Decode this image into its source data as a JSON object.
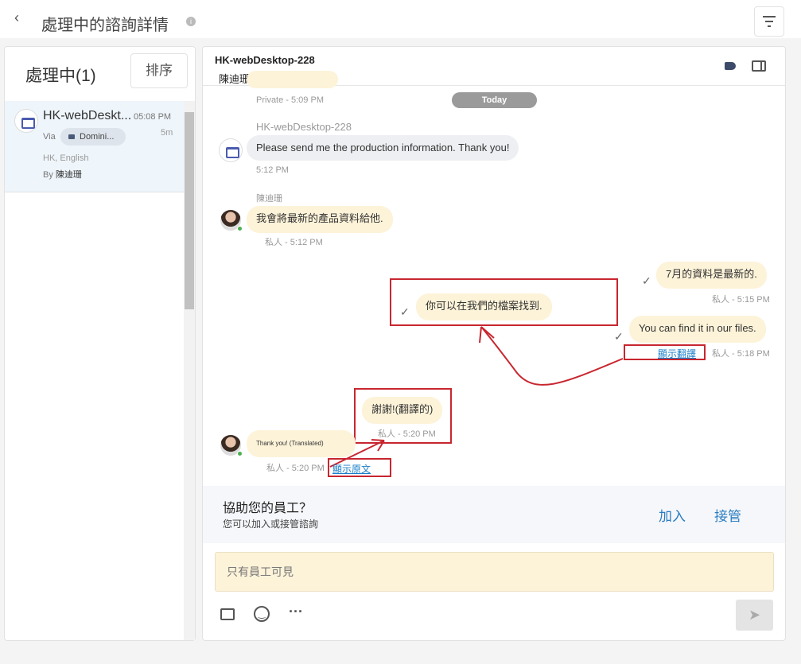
{
  "header": {
    "title": "處理中的諮詢詳情",
    "back_icon": "chevron-left-icon",
    "info_icon": "info-icon",
    "filter_icon": "filter-icon"
  },
  "sidebar": {
    "title": "處理中",
    "count": "(1)",
    "sort_label": "排序",
    "items": [
      {
        "name": "HK-webDeskt...",
        "time": "05:08 PM",
        "via": "Via",
        "channel": "Domini...",
        "elapsed": "5m",
        "locale": "HK, English",
        "by": "By",
        "agent": "陳迪珊"
      }
    ]
  },
  "chat": {
    "title": "HK-webDesktop-228",
    "subtitle": "陳迪珊",
    "today": "Today",
    "messages": [
      {
        "meta": "Private - 5:09 PM"
      },
      {
        "sender": "HK-webDesktop-228",
        "text": "Please send me the production information. Thank you!",
        "meta": "5:12 PM"
      },
      {
        "sender": "陳迪珊",
        "text": "我會將最新的產品資料給他.",
        "meta": "私人 - 5:12 PM"
      },
      {
        "text": "7月的資料是最新的.",
        "meta": "私人 - 5:15 PM"
      },
      {
        "text": "你可以在我們的檔案找到."
      },
      {
        "text": "You can find it in our files.",
        "link": "顯示翻譯",
        "meta": "私人 - 5:18 PM"
      },
      {
        "text": "謝謝!(翻譯的)",
        "meta": "私人 - 5:20 PM"
      },
      {
        "text": "Thank you! (Translated)",
        "meta": "私人 - 5:20 PM",
        "link": "顯示原文"
      }
    ]
  },
  "assist": {
    "title": "協助您的員工？",
    "subtitle": "您可以加入或接管諮詢",
    "join": "加入",
    "takeover": "接管"
  },
  "composer": {
    "placeholder": "只有員工可見"
  }
}
